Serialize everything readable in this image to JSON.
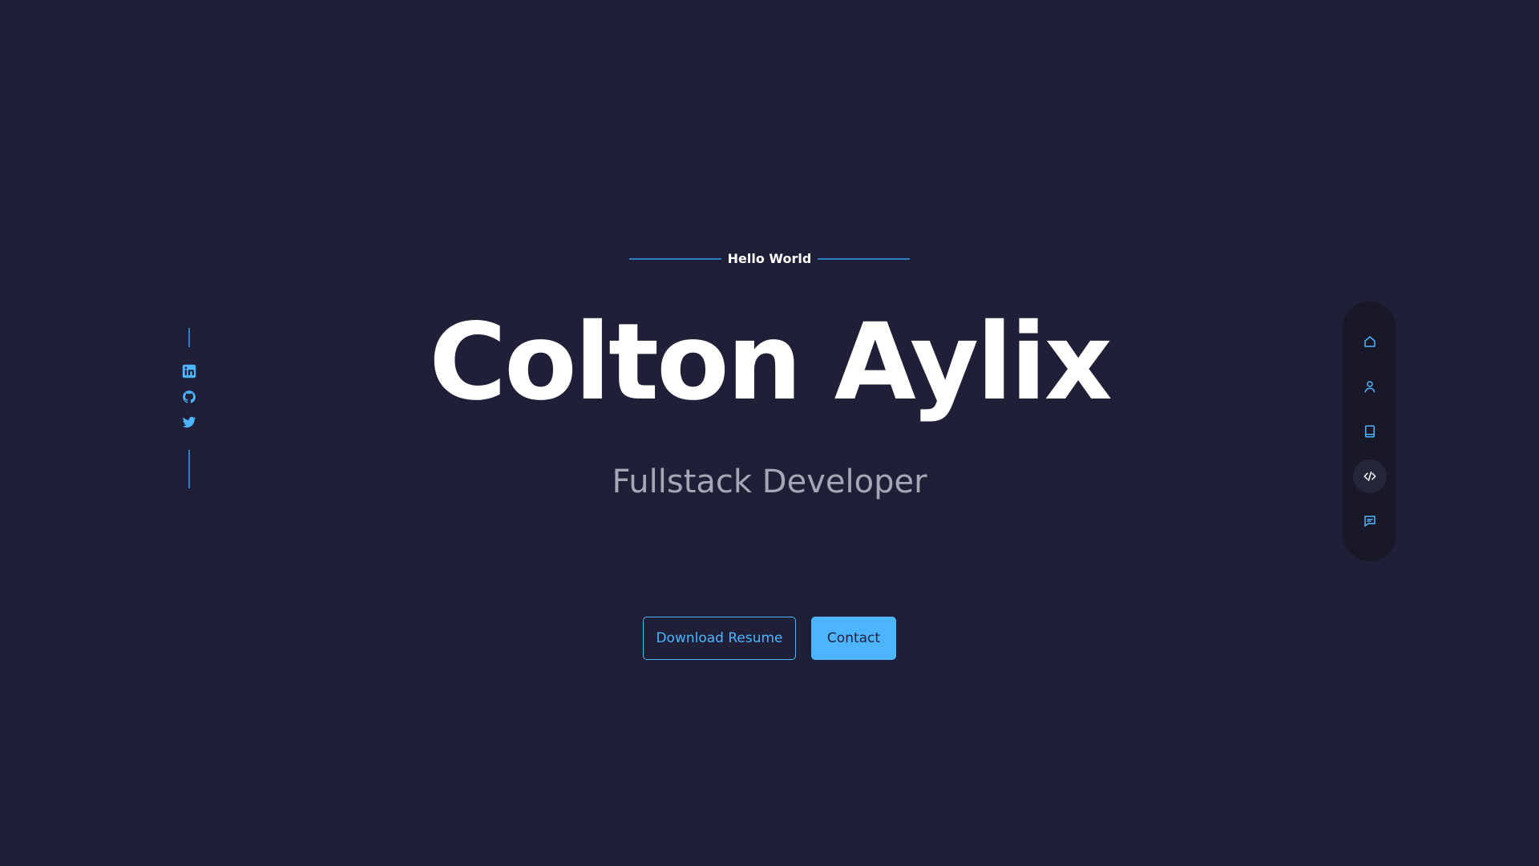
{
  "hero": {
    "eyebrow": "Hello World",
    "name": "Colton Aylix",
    "role": "Fullstack Developer"
  },
  "cta": {
    "download_label": "Download Resume",
    "contact_label": "Contact"
  },
  "socials": [
    {
      "icon": "linkedin-icon"
    },
    {
      "icon": "github-icon"
    },
    {
      "icon": "twitter-icon"
    }
  ],
  "nav": {
    "items": [
      {
        "icon": "home-icon",
        "active": false
      },
      {
        "icon": "user-icon",
        "active": false
      },
      {
        "icon": "book-icon",
        "active": false
      },
      {
        "icon": "code-icon",
        "active": true
      },
      {
        "icon": "message-icon",
        "active": false
      }
    ]
  },
  "colors": {
    "background": "#1f1f38",
    "accent": "#4db5ff",
    "nav_background": "#181828",
    "muted_text": "#a6a6b7"
  }
}
